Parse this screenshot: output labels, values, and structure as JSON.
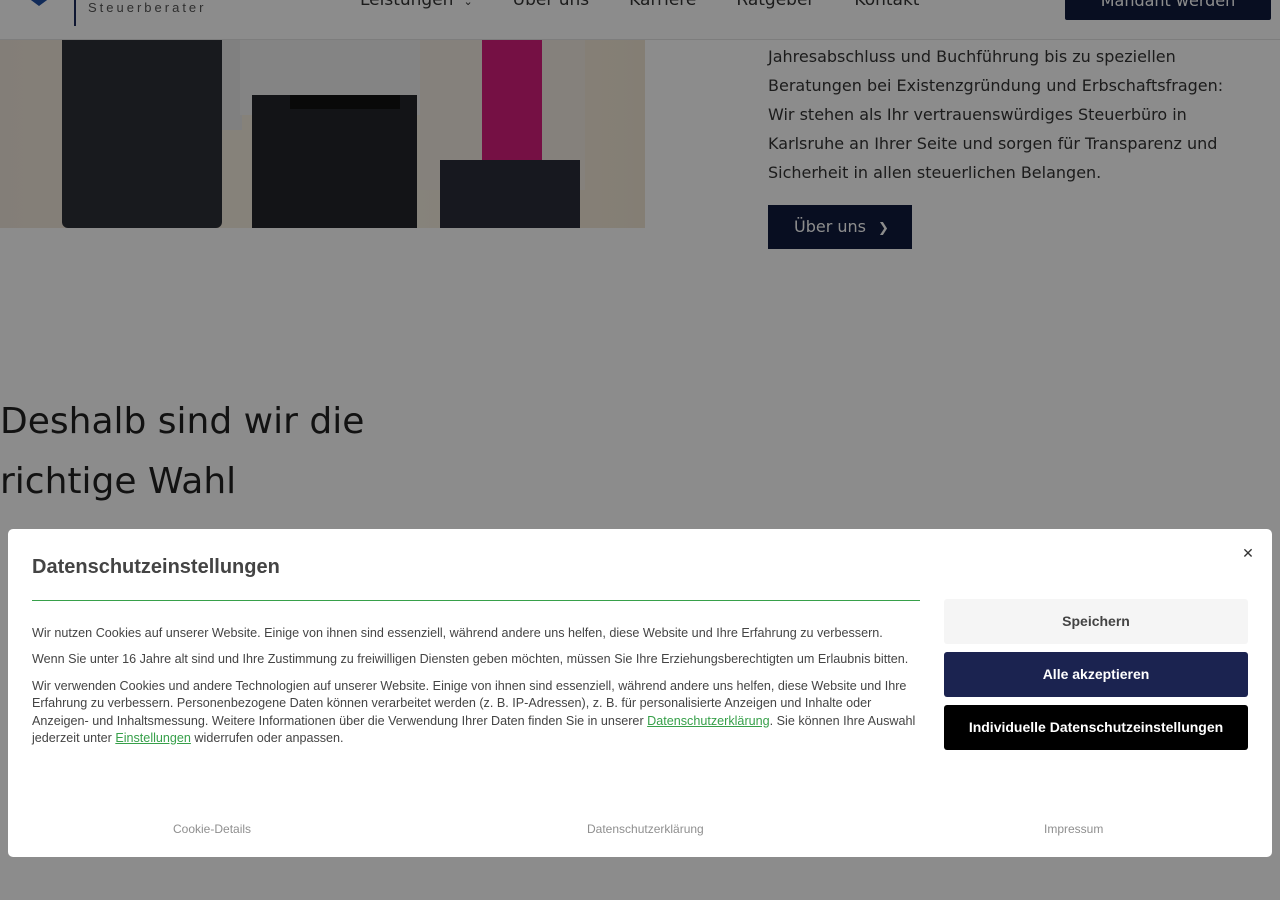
{
  "header": {
    "logo_text": "Steuerberater",
    "nav": [
      "Leistungen",
      "Über uns",
      "Karriere",
      "Ratgeber",
      "Kontakt"
    ],
    "cta_label": "Mandant werden"
  },
  "about": {
    "text": "Jahresabschluss und Buchführung bis zu speziellen Beratungen bei Existenzgründung und Erbschaftsfragen: Wir stehen als Ihr vertrauenswürdiges Steuerbüro in Karlsruhe an Ihrer Seite und sorgen für Transparenz und Sicherheit in allen steuerlichen Belangen.",
    "button_label": "Über uns"
  },
  "why": {
    "title_line1": "Deshalb sind wir die",
    "title_line2": "richtige Wahl"
  },
  "cookie_dialog": {
    "title": "Datenschutzeinstellungen",
    "close_symbol": "✕",
    "paragraph1": "Wir nutzen Cookies auf unserer Website. Einige von ihnen sind essenziell, während andere uns helfen, diese Website und Ihre Erfahrung zu verbessern.",
    "paragraph2": "Wenn Sie unter 16 Jahre alt sind und Ihre Zustimmung zu freiwilligen Diensten geben möchten, müssen Sie Ihre Erziehungsberechtigten um Erlaubnis bitten.",
    "paragraph3_part1": "Wir verwenden Cookies und andere Technologien auf unserer Website. Einige von ihnen sind essenziell, während andere uns helfen, diese Website und Ihre Erfahrung zu verbessern. Personenbezogene Daten können verarbeitet werden (z. B. IP-Adressen), z. B. für personalisierte Anzeigen und Inhalte oder Anzeigen- und Inhaltsmessung. Weitere Informationen über die Verwendung Ihrer Daten finden Sie in unserer ",
    "paragraph3_link1": "Datenschutzerklärung",
    "paragraph3_part2": ". Sie können Ihre Auswahl jederzeit unter ",
    "paragraph3_link2": "Einstellungen",
    "paragraph3_part3": " widerrufen oder anpassen.",
    "save_label": "Speichern",
    "accept_all_label": "Alle akzeptieren",
    "individual_label": "Individuelle Datenschutzeinstellungen",
    "footer_links": [
      "Cookie-Details",
      "Datenschutzerklärung",
      "Impressum"
    ]
  },
  "colors": {
    "brand_navy": "#1b2350",
    "accent_green": "#37a04a"
  }
}
